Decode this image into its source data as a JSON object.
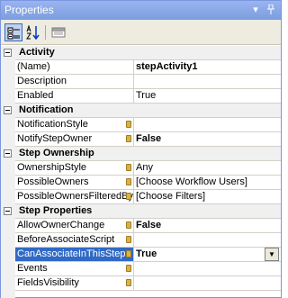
{
  "window": {
    "title": "Properties"
  },
  "titlebar_icons": {
    "dropdown": "dropdown-arrow-icon",
    "pin": "pin-icon"
  },
  "toolbar_icons": [
    "categorized-icon",
    "alphabetical-sort-icon",
    "property-pages-icon"
  ],
  "categories": [
    {
      "label": "Activity",
      "rows": [
        {
          "name": "(Name)",
          "value": "stepActivity1",
          "bold": true,
          "lock": false
        },
        {
          "name": "Description",
          "value": "",
          "bold": false,
          "lock": false
        },
        {
          "name": "Enabled",
          "value": "True",
          "bold": false,
          "lock": false
        }
      ]
    },
    {
      "label": "Notification",
      "rows": [
        {
          "name": "NotificationStyle",
          "value": "",
          "bold": false,
          "lock": true
        },
        {
          "name": "NotifyStepOwner",
          "value": "False",
          "bold": true,
          "lock": true
        }
      ]
    },
    {
      "label": "Step Ownership",
      "rows": [
        {
          "name": "OwnershipStyle",
          "value": "Any",
          "bold": false,
          "lock": true
        },
        {
          "name": "PossibleOwners",
          "value": "[Choose Workflow Users]",
          "bold": false,
          "lock": true
        },
        {
          "name": "PossibleOwnersFilteredBy",
          "value": "[Choose Filters]",
          "bold": false,
          "lock": true
        }
      ]
    },
    {
      "label": "Step Properties",
      "rows": [
        {
          "name": "AllowOwnerChange",
          "value": "False",
          "bold": true,
          "lock": true
        },
        {
          "name": "BeforeAssociateScript",
          "value": "",
          "bold": false,
          "lock": true
        },
        {
          "name": "CanAssociateInThisStep",
          "value": "True",
          "bold": true,
          "lock": true,
          "selected": true,
          "dropdown": true
        },
        {
          "name": "Events",
          "value": "",
          "bold": false,
          "lock": true
        },
        {
          "name": "FieldsVisibility",
          "value": "",
          "bold": false,
          "lock": true
        }
      ]
    }
  ]
}
